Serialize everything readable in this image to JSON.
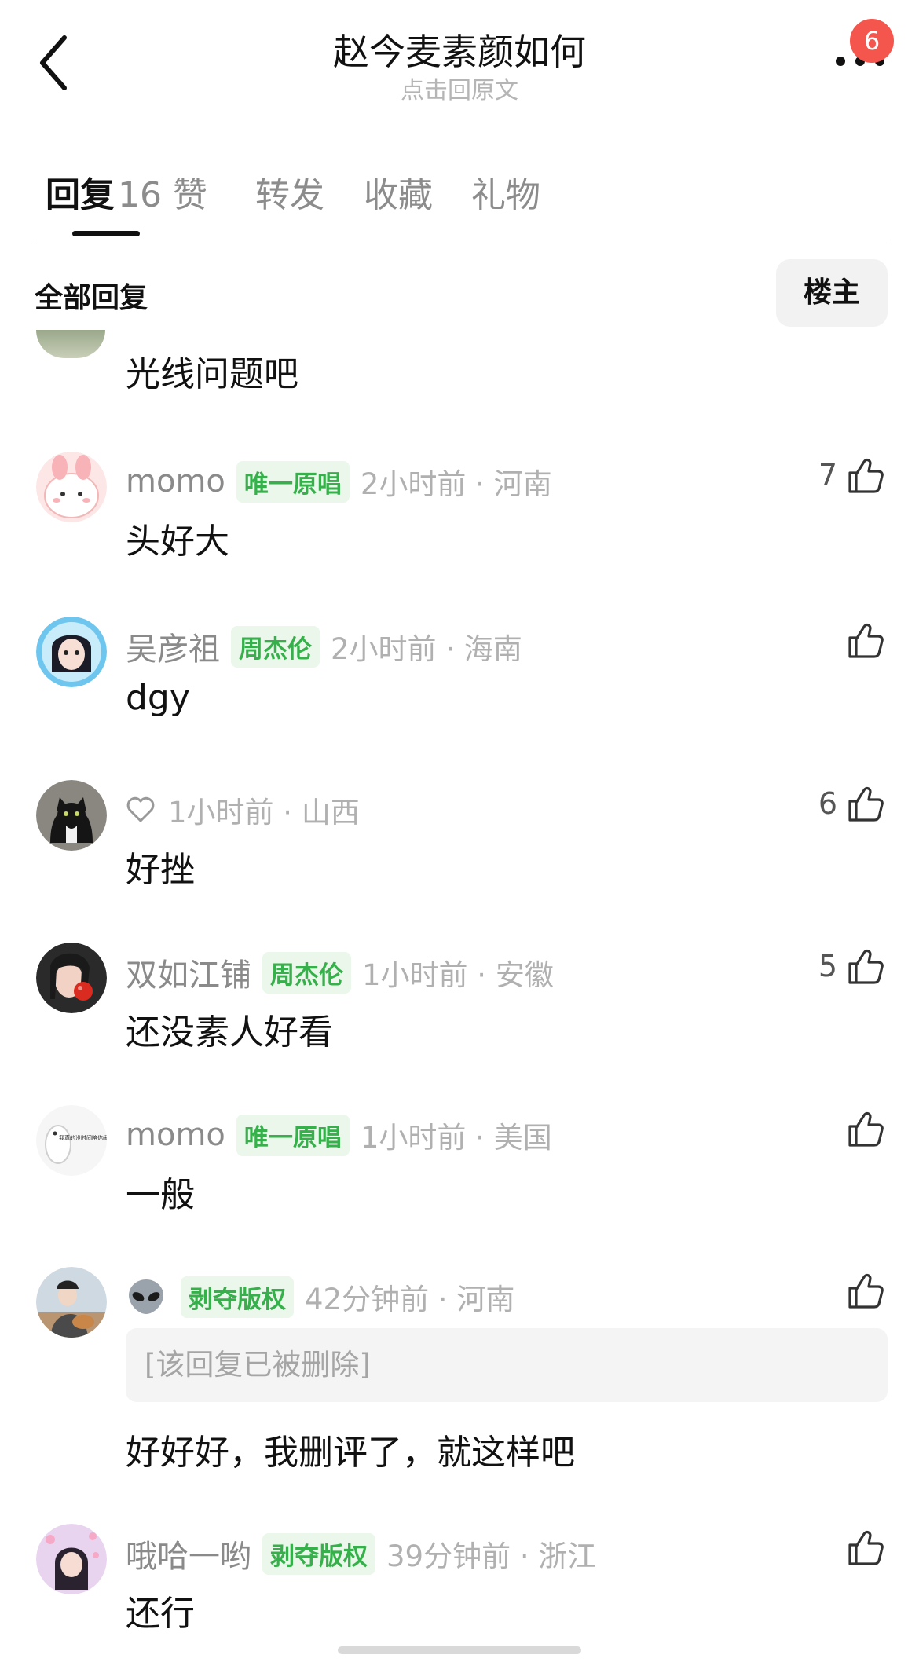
{
  "header": {
    "title": "赵今麦素颜如何",
    "subtitle": "点击回原文",
    "more_badge": "6"
  },
  "tabs": [
    {
      "label": "回复",
      "count": "16",
      "active": true
    },
    {
      "label": "赞"
    },
    {
      "label": "转发"
    },
    {
      "label": "收藏"
    },
    {
      "label": "礼物"
    }
  ],
  "section": {
    "title": "全部回复",
    "owner_button": "楼主"
  },
  "partial_comment": {
    "text": "光线问题吧"
  },
  "comments": [
    {
      "username": "momo",
      "tag": "唯一原唱",
      "time": "2小时前 · 河南",
      "text": "头好大",
      "likes": "7",
      "avatar_icon": "pink-bunny-avatar"
    },
    {
      "username": "吴彦祖",
      "tag": "周杰伦",
      "time": "2小时前 · 海南",
      "text": "dgy",
      "likes": "",
      "avatar_icon": "anime-girl-avatar"
    },
    {
      "username": "",
      "tag": "",
      "time": "1小时前 · 山西",
      "text": "好挫",
      "likes": "6",
      "avatar_icon": "black-cat-avatar",
      "name_icon": "heart-outline-icon"
    },
    {
      "username": "双如江铺",
      "tag": "周杰伦",
      "time": "1小时前 · 安徽",
      "text": "还没素人好看",
      "likes": "5",
      "avatar_icon": "girl-apple-avatar"
    },
    {
      "username": "momo",
      "tag": "唯一原唱",
      "time": "1小时前 · 美国",
      "text": "一般",
      "likes": "",
      "avatar_icon": "white-bear-avatar",
      "avatar_text": "我真的没时间陪你闹了"
    },
    {
      "username": "",
      "tag": "剥夺版权",
      "time": "42分钟前 · 河南",
      "quoted": "[该回复已被删除]",
      "text": "好好好，我删评了，就这样吧",
      "likes": "",
      "avatar_icon": "guitar-boy-avatar",
      "name_icon": "alien-icon"
    },
    {
      "username": "哦哈一哟",
      "tag": "剥夺版权",
      "time": "39分钟前 · 浙江",
      "text": "还行",
      "likes": "",
      "avatar_icon": "sakura-girl-avatar"
    }
  ],
  "colors": {
    "tag_green": "#36b04a",
    "tag_bg": "#eaf7ea",
    "badge_red": "#f4554d",
    "muted": "#b0b0b0"
  }
}
